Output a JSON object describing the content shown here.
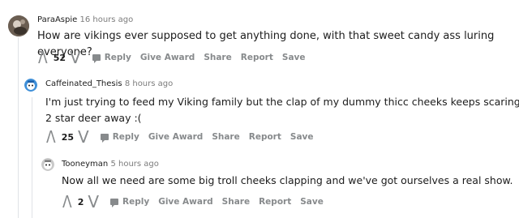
{
  "comments": [
    {
      "username": "ParaAspie",
      "time": "16 hours ago",
      "body": "How are vikings ever supposed to get anything done, with that sweet candy ass luring everyone?",
      "score": "52"
    },
    {
      "username": "Caffeinated_Thesis",
      "time": "8 hours ago",
      "body_line1": "I'm just trying to feed my Viking family but the clap of my dummy thicc cheeks keeps scaring the",
      "body_line2": "2 star deer away :(",
      "score": "25"
    },
    {
      "username": "Tooneyman",
      "time": "5 hours ago",
      "body": "Now all we need are some big troll cheeks clapping and we've got ourselves a real show.",
      "score": "2"
    }
  ],
  "actions": {
    "reply": "Reply",
    "give_award": "Give Award",
    "share": "Share",
    "report": "Report",
    "save": "Save"
  },
  "icons": {
    "upvote": "Λ",
    "downvote": "V"
  }
}
